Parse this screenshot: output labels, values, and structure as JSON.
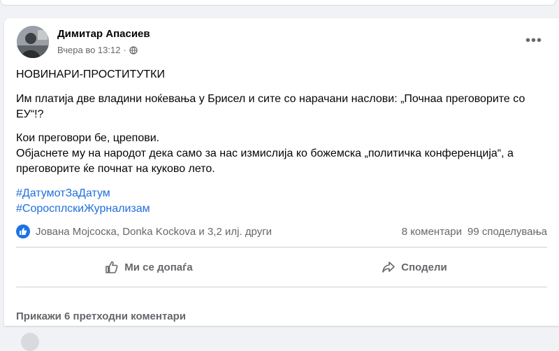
{
  "post": {
    "author": "Димитар Апасиев",
    "timestamp": "Вчера во 13:12",
    "privacy_icon": "globe-icon",
    "more_icon": "more-horizontal-icon",
    "headline": "НОВИНАРИ-ПРОСТИТУТКИ",
    "paragraph1": "Им платија две владини ноќевања у Брисел и сите со нарачани наслови: „Почнаа преговорите со ЕУ“!?",
    "paragraph2_line1": "Кои преговори бе, црепови.",
    "paragraph2_line2": "Објаснете му на народот дека само за нас измислија ко божемска „политичка конференција“, а преговорите ќе почнат на куково лето.",
    "hashtags": [
      "#ДатумотЗаДатум",
      "#СоросплскиЖурнализам"
    ]
  },
  "stats": {
    "reaction_icon": "like-icon",
    "reactors": "Јована Мојсоска, Donka Kockova и 3,2 илј. други",
    "comments": "8 коментари",
    "shares": "99 споделувања"
  },
  "actions": {
    "like_label": "Ми се допаѓа",
    "share_label": "Сподели"
  },
  "comments": {
    "show_previous": "Прикажи 6 претходни коментари"
  },
  "colors": {
    "link": "#216fdb",
    "like_badge": "#1b74e4",
    "secondary_text": "#65676b"
  }
}
